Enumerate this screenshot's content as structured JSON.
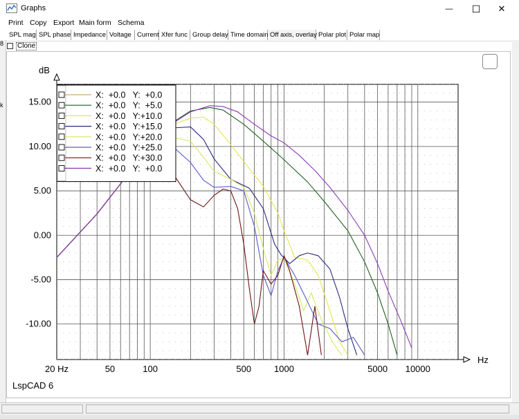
{
  "window": {
    "title": "Graphs",
    "close_glyph": "✕",
    "maximize_glyph": "☐",
    "minimize_glyph": "—"
  },
  "menu": [
    {
      "label": "Print"
    },
    {
      "label": "Copy"
    },
    {
      "label": "Export"
    },
    {
      "label": "Main form"
    },
    {
      "label": "Schema"
    }
  ],
  "tabs": [
    {
      "label": "SPL mag"
    },
    {
      "label": "SPL phase"
    },
    {
      "label": "Impedance"
    },
    {
      "label": "Voltage"
    },
    {
      "label": "Current"
    },
    {
      "label": "Xfer func"
    },
    {
      "label": "Group delay"
    },
    {
      "label": "Time domain"
    },
    {
      "label": "Off axis, overlay",
      "active": true
    },
    {
      "label": "Polar plot"
    },
    {
      "label": "Polar map"
    }
  ],
  "clone": {
    "label": "Clone",
    "checked": false
  },
  "left_strip": {
    "chars": [
      "8",
      "k"
    ]
  },
  "watermark": "LspCAD 6",
  "chart_data": {
    "type": "line",
    "x_scale": "log",
    "xlim": [
      20,
      20000
    ],
    "ylim": [
      -14,
      17
    ],
    "ylabel": "dB",
    "xlabel": "Hz",
    "y_ticks": [
      {
        "value": 15,
        "label": "15.00"
      },
      {
        "value": 10,
        "label": "10.00"
      },
      {
        "value": 5,
        "label": "5.00"
      },
      {
        "value": 0,
        "label": "0.00"
      },
      {
        "value": -5,
        "label": "-5.00"
      },
      {
        "value": -10,
        "label": "-10.00"
      }
    ],
    "x_ticks": [
      {
        "value": 20,
        "label": "20 Hz"
      },
      {
        "value": 50,
        "label": "50"
      },
      {
        "value": 100,
        "label": "100"
      },
      {
        "value": 500,
        "label": "500"
      },
      {
        "value": 1000,
        "label": "1000"
      },
      {
        "value": 5000,
        "label": "5000"
      },
      {
        "value": 10000,
        "label": "10000"
      }
    ],
    "grid": true,
    "legend_position": "top-left",
    "series": [
      {
        "name": "X:  +0.0   Y:  +0.0",
        "color": "#d2a679",
        "points": [
          [
            20,
            -2.5
          ],
          [
            40,
            2.4
          ],
          [
            60,
            5.8
          ],
          [
            80,
            8.4
          ],
          [
            100,
            10.2
          ]
        ]
      },
      {
        "name": "X:  +0.0   Y:  +5.0",
        "color": "#1f5f1f",
        "points": [
          [
            20,
            -2.5
          ],
          [
            40,
            2.4
          ],
          [
            60,
            5.8
          ],
          [
            80,
            8.4
          ],
          [
            100,
            10.2
          ],
          [
            150,
            12.8
          ],
          [
            200,
            14.0
          ],
          [
            280,
            14.4
          ],
          [
            350,
            14.1
          ],
          [
            500,
            12.5
          ],
          [
            700,
            10.6
          ],
          [
            1000,
            8.5
          ],
          [
            1500,
            6.0
          ],
          [
            2000,
            3.8
          ],
          [
            3000,
            0.5
          ],
          [
            4000,
            -3.0
          ],
          [
            5000,
            -6.5
          ],
          [
            6000,
            -10.0
          ],
          [
            7000,
            -13.5
          ]
        ]
      },
      {
        "name": "X:  +0.0   Y:+10.0",
        "color": "#e4e452",
        "points": [
          [
            20,
            -2.5
          ],
          [
            40,
            2.4
          ],
          [
            60,
            5.8
          ],
          [
            80,
            8.4
          ],
          [
            100,
            10.2
          ],
          [
            150,
            12.5
          ],
          [
            200,
            13.2
          ],
          [
            250,
            13.3
          ],
          [
            300,
            12.5
          ],
          [
            400,
            10.2
          ],
          [
            500,
            8.3
          ],
          [
            700,
            5.5
          ],
          [
            900,
            2.5
          ],
          [
            1000,
            0.5
          ],
          [
            1200,
            -2.5
          ],
          [
            1500,
            -2.8
          ],
          [
            1800,
            -4.5
          ],
          [
            2200,
            -8.5
          ],
          [
            2600,
            -12.0
          ],
          [
            3000,
            -13.5
          ]
        ]
      },
      {
        "name": "X:  +0.0   Y:+15.0",
        "color": "#28287f",
        "points": [
          [
            20,
            -2.5
          ],
          [
            40,
            2.4
          ],
          [
            60,
            5.8
          ],
          [
            80,
            8.4
          ],
          [
            100,
            10.2
          ],
          [
            150,
            12.1
          ],
          [
            200,
            12.2
          ],
          [
            250,
            10.8
          ],
          [
            300,
            8.6
          ],
          [
            400,
            6.3
          ],
          [
            550,
            5.3
          ],
          [
            700,
            3.0
          ],
          [
            850,
            -1.0
          ],
          [
            950,
            -2.2
          ],
          [
            1100,
            -3.2
          ],
          [
            1300,
            -2.3
          ],
          [
            1500,
            -2.0
          ],
          [
            1800,
            -2.3
          ],
          [
            2200,
            -3.8
          ],
          [
            2600,
            -7.0
          ],
          [
            3000,
            -10.5
          ],
          [
            3500,
            -13.5
          ]
        ]
      },
      {
        "name": "X:  +0.0   Y:+20.0",
        "color": "#d9e860",
        "points": [
          [
            20,
            -2.5
          ],
          [
            40,
            2.4
          ],
          [
            60,
            5.8
          ],
          [
            80,
            8.4
          ],
          [
            100,
            10.2
          ],
          [
            150,
            11.0
          ],
          [
            200,
            10.6
          ],
          [
            250,
            8.8
          ],
          [
            300,
            7.2
          ],
          [
            400,
            6.3
          ],
          [
            500,
            5.4
          ],
          [
            600,
            2.5
          ],
          [
            700,
            -1.5
          ],
          [
            800,
            -4.5
          ],
          [
            900,
            -2.8
          ],
          [
            1000,
            -2.6
          ],
          [
            1200,
            -5.5
          ],
          [
            1400,
            -8.5
          ],
          [
            1600,
            -6.5
          ],
          [
            1900,
            -9.5
          ],
          [
            2300,
            -12.0
          ],
          [
            2700,
            -13.5
          ]
        ]
      },
      {
        "name": "X:  +0.0   Y:+25.0",
        "color": "#5a5ac8",
        "points": [
          [
            20,
            -2.5
          ],
          [
            40,
            2.4
          ],
          [
            60,
            5.8
          ],
          [
            80,
            8.4
          ],
          [
            100,
            10.2
          ],
          [
            150,
            9.9
          ],
          [
            200,
            8.2
          ],
          [
            250,
            6.2
          ],
          [
            300,
            5.4
          ],
          [
            400,
            5.5
          ],
          [
            500,
            5.0
          ],
          [
            600,
            1.0
          ],
          [
            700,
            -4.5
          ],
          [
            800,
            -6.8
          ],
          [
            900,
            -4.0
          ],
          [
            1000,
            -2.5
          ],
          [
            1200,
            -4.5
          ],
          [
            1500,
            -7.5
          ],
          [
            1800,
            -10.0
          ],
          [
            2200,
            -10.5
          ],
          [
            2700,
            -12.0
          ],
          [
            3300,
            -11.5
          ],
          [
            4000,
            -13.5
          ]
        ]
      },
      {
        "name": "X:  +0.0   Y:+30.0",
        "color": "#6b1414",
        "points": [
          [
            20,
            -2.5
          ],
          [
            40,
            2.4
          ],
          [
            60,
            5.8
          ],
          [
            80,
            8.4
          ],
          [
            100,
            9.0
          ],
          [
            120,
            8.6
          ],
          [
            150,
            6.8
          ],
          [
            200,
            4.0
          ],
          [
            250,
            3.2
          ],
          [
            300,
            4.5
          ],
          [
            350,
            5.2
          ],
          [
            400,
            5.0
          ],
          [
            450,
            3.0
          ],
          [
            500,
            -1.0
          ],
          [
            550,
            -6.0
          ],
          [
            600,
            -10.0
          ],
          [
            650,
            -8.0
          ],
          [
            700,
            -4.0
          ],
          [
            800,
            -5.5
          ],
          [
            900,
            -4.5
          ],
          [
            1000,
            -2.3
          ],
          [
            1100,
            -4.0
          ],
          [
            1300,
            -8.0
          ],
          [
            1500,
            -13.5
          ],
          [
            1700,
            -8.0
          ],
          [
            1900,
            -13.5
          ]
        ]
      },
      {
        "name": "X:  +0.0   Y:  +0.0",
        "color": "#8a3ab0",
        "points": [
          [
            20,
            -2.5
          ],
          [
            40,
            2.4
          ],
          [
            60,
            5.8
          ],
          [
            80,
            8.4
          ],
          [
            100,
            10.2
          ],
          [
            150,
            12.7
          ],
          [
            200,
            13.9
          ],
          [
            280,
            14.6
          ],
          [
            350,
            14.5
          ],
          [
            450,
            13.9
          ],
          [
            600,
            12.5
          ],
          [
            800,
            11.2
          ],
          [
            1000,
            10.4
          ],
          [
            1300,
            9.0
          ],
          [
            1700,
            7.3
          ],
          [
            2200,
            5.4
          ],
          [
            3000,
            2.8
          ],
          [
            4000,
            0.0
          ],
          [
            5000,
            -3.2
          ],
          [
            6000,
            -6.3
          ],
          [
            7500,
            -9.7
          ],
          [
            9000,
            -12.7
          ]
        ]
      }
    ]
  },
  "status": {
    "panes": [
      "",
      ""
    ]
  }
}
